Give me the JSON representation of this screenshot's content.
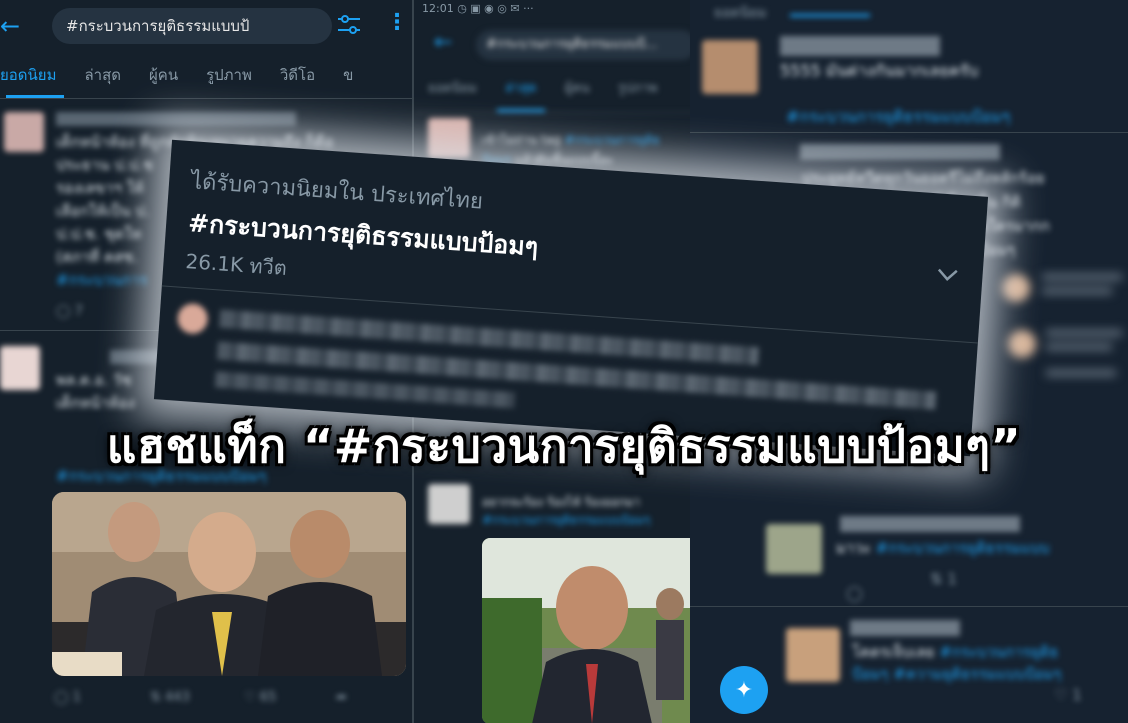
{
  "left_panel": {
    "search_value": "#กระบวนการยุติธรรมแบบป้",
    "tabs": [
      "ยอดนิยม",
      "ล่าสุด",
      "ผู้คน",
      "รูปภาพ",
      "วิดีโอ",
      "ข"
    ],
    "tweet1_lines": [
      "เด็กหน้าห้อง ที่ถูกทักพิณหมายความถึง ก็คือ",
      "ประธาน ป.ป.ช",
      "รองเลขาฯ ให้",
      "เลือกให้เป็น ป.",
      "ป.ป.ช. ชุดให",
      "(สภาที่ คสช."
    ],
    "tweet1_tag": "#กระบวนการ",
    "tweet1_reply_count": "7",
    "tweet2_lines": [
      "พล.ต.อ. วัช",
      "เด็กหน้าห้อง"
    ],
    "tweet2_tag": "#กระบวนการยุติธรรมแบบป้อมๆ",
    "photo_actions": {
      "reply": "1",
      "retweet": "443",
      "like": "65"
    }
  },
  "mid_panel": {
    "status_bar": "12:01 ◷ ▣ ◉ ◎ ✉ ···",
    "search_value": "#กระบวนการยุติธรรมแบบป้...",
    "tabs": [
      "ยอดนิยม",
      "ล่าสุด",
      "ผู้คน",
      "รูปภาพ"
    ],
    "tweet1_text": "เข้าไม่ถ่าน tag",
    "tweet1_tag": "#กระบวนการยุติธ",
    "tweet1_tag2": "ป้อมๆ",
    "tweet1_rest": "แล้วฝันชิ้นแบบนี้อะ",
    "tweet2_text": "อยากจะร้อง ร้องไห้ ร้องออกมา",
    "tweet2_tag": "#กระบวนการยุติธรรมแบบป้อมๆ"
  },
  "right_panel": {
    "tab_label": "ยอดนิยม",
    "tweet1_text": "5555 มันต่างกันมากเลยครับ",
    "tweet1_tag": "#กระบวนการยุติธรรมแบบป้อมๆ",
    "tweet2_lines": [
      "ประยุทธ์ทวีตทุกวันยอดรีไม่ถึงหลักร้อย",
      "ป้อมนานๆ เล่นทียอดรีเป็นหมื่น กิติ",
      "อวดคนไทยเชื่อใครมากก",
      "แบบป้อมๆ"
    ],
    "tweet3_text": "มาวะ",
    "tweet3_tag": "#กระบวนการยุติธรรมแบบ",
    "tweet3_retweets": "1",
    "tweet4_text": "โคตรเจ็บเลย",
    "tweet4_tag": "#กระบวนการยุติธ",
    "tweet4_line2_tag1": "ป้อมๆ",
    "tweet4_line2_tag2": "#ความยุติธรรมแบบป้อมๆ",
    "tweet4_likes": "1"
  },
  "trend_card": {
    "subtitle": "ได้รับความนิยมใน ประเทศไทย",
    "hashtag": "#กระบวนการยุติธรรมแบบป้อมๆ",
    "tweet_count": "26.1K ทวีต"
  },
  "headline": "แฮชแท็ก “#กระบวนการยุติธรรมแบบป้อมๆ”",
  "colors": {
    "background": "#15202b",
    "accent": "#1da1f2",
    "text": "#e1e8ed",
    "muted": "#8899a6",
    "glow": "#dce1e8"
  }
}
